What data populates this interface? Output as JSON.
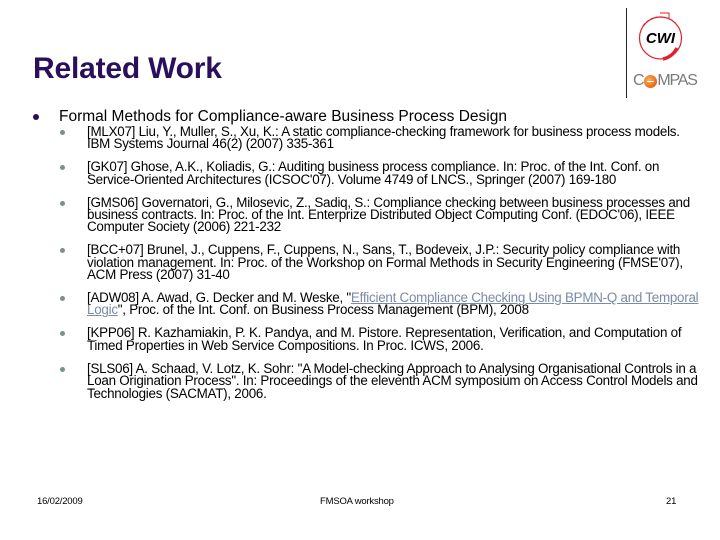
{
  "slide": {
    "title": "Related Work",
    "main_item": "Formal Methods for Compliance-aware Business Process Design",
    "references": [
      {
        "text": "[MLX07] Liu, Y., Muller, S., Xu, K.: A static compliance-checking framework for business process models. IBM Systems Journal 46(2) (2007) 335-361"
      },
      {
        "text": "[GK07] Ghose, A.K., Koliadis, G.: Auditing business process compliance. In: Proc. of the Int. Conf. on Service-Oriented Architectures (ICSOC'07). Volume 4749 of LNCS., Springer (2007) 169-180"
      },
      {
        "text": "[GMS06] Governatori, G., Milosevic, Z., Sadiq, S.: Compliance checking between business processes and business contracts. In: Proc. of the Int. Enterprize Distributed Object Computing Conf. (EDOC'06), IEEE Computer Society (2006) 221-232"
      },
      {
        "text": "[BCC+07] Brunel, J., Cuppens, F., Cuppens, N., Sans, T., Bodeveix, J.P.: Security policy compliance with violation management. In: Proc. of the Workshop on Formal Methods in Security Engineering (FMSE'07), ACM Press (2007) 31-40"
      },
      {
        "prefix": "[ADW08] A. Awad, G. Decker and M. Weske, \"",
        "link": "Efficient Compliance Checking Using BPMN-Q and Temporal Logic",
        "suffix": "\", Proc. of the Int. Conf. on Business Process Management (BPM), 2008"
      },
      {
        "text": "[KPP06] R. Kazhamiakin, P. K. Pandya, and M. Pistore. Representation, Verification, and Computation of Timed Properties in Web Service Compositions. In Proc. ICWS, 2006."
      },
      {
        "text": "[SLS06] A. Schaad, V. Lotz, K. Sohr: \"A Model-checking Approach to Analysing Organisational Controls in a Loan Origination Process\". In: Proceedings of the eleventh ACM symposium on Access Control Models and Technologies (SACMAT), 2006."
      }
    ]
  },
  "logos": {
    "cwi": "CWI",
    "compas_prefix": "C",
    "compas_suffix": "MPAS"
  },
  "footer": {
    "date": "16/02/2009",
    "event": "FMSOA workshop",
    "page": "21"
  },
  "colors": {
    "title": "#2a0f5c",
    "link": "#7a8aa8",
    "cwi_red": "#e0202a",
    "compas_orange": "#e8661a"
  }
}
